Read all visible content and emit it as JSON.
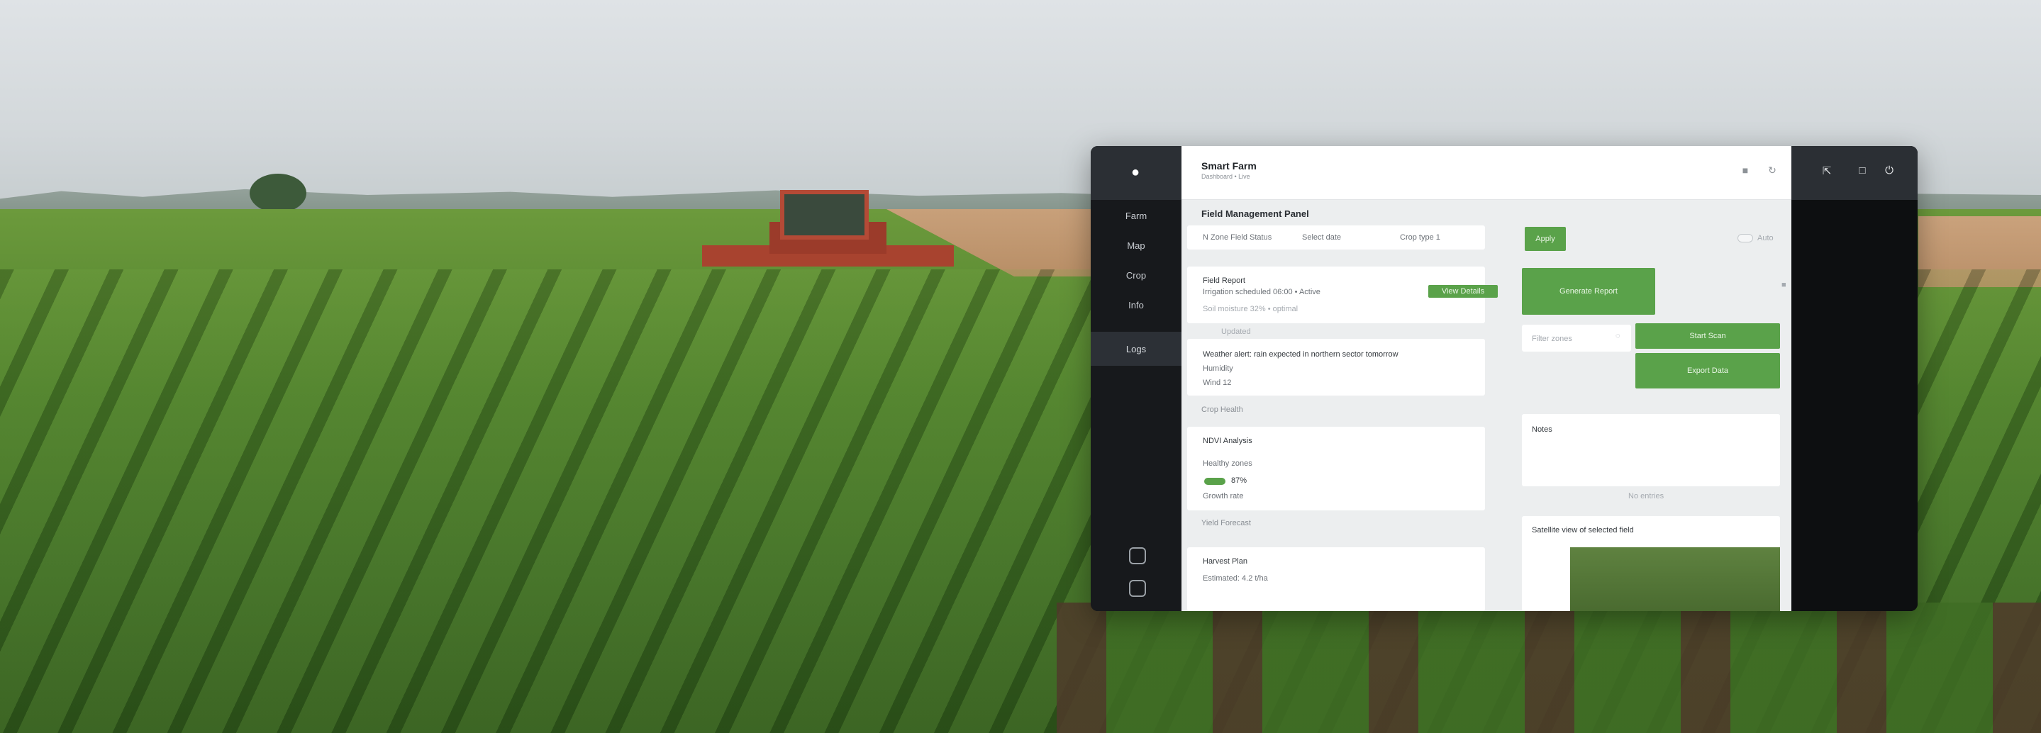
{
  "app": {
    "title": "Smart Farm",
    "subtitle": "Dashboard • Live"
  },
  "sidebar": {
    "items": [
      {
        "label": "Farm"
      },
      {
        "label": "Map"
      },
      {
        "label": "Crop"
      },
      {
        "label": "Info"
      },
      {
        "label": "Logs"
      }
    ]
  },
  "topbar": {
    "icons": [
      "settings-icon",
      "refresh-icon"
    ]
  },
  "rightbar": {
    "icons": [
      "expand-icon",
      "help-icon",
      "power-icon"
    ]
  },
  "main": {
    "section_title": "Field Management Panel",
    "filter_bar": {
      "field_1": "N Zone  Field Status",
      "field_2": "Select date",
      "field_3": "Crop type  1",
      "apply_label": "Apply",
      "toggle_label": "Auto"
    },
    "card_1": {
      "title": "Field Report",
      "line_1": "Irrigation scheduled 06:00 • Active",
      "line_2": "Soil moisture 32% • optimal",
      "action_label": "View Details"
    },
    "card_1_note": "Updated",
    "card_2": {
      "line_1": "Weather alert: rain expected in northern sector tomorrow",
      "line_2": "Humidity",
      "line_3": "Wind 12"
    },
    "divider_1": "Crop Health",
    "card_3": {
      "title": "NDVI Analysis",
      "line_1": "Healthy zones",
      "badge_value": "87%",
      "line_2": "Growth rate"
    },
    "divider_2": "Yield Forecast",
    "card_4": {
      "title": "Harvest Plan",
      "line_1": "Estimated: 4.2 t/ha"
    }
  },
  "right_panel": {
    "primary_action": "Generate Report",
    "search_label": "Filter zones",
    "action_1": "Start Scan",
    "action_2": "Export Data",
    "card_title": "Notes",
    "card_caption": "No entries",
    "image_card_title": "Satellite view of selected field"
  }
}
